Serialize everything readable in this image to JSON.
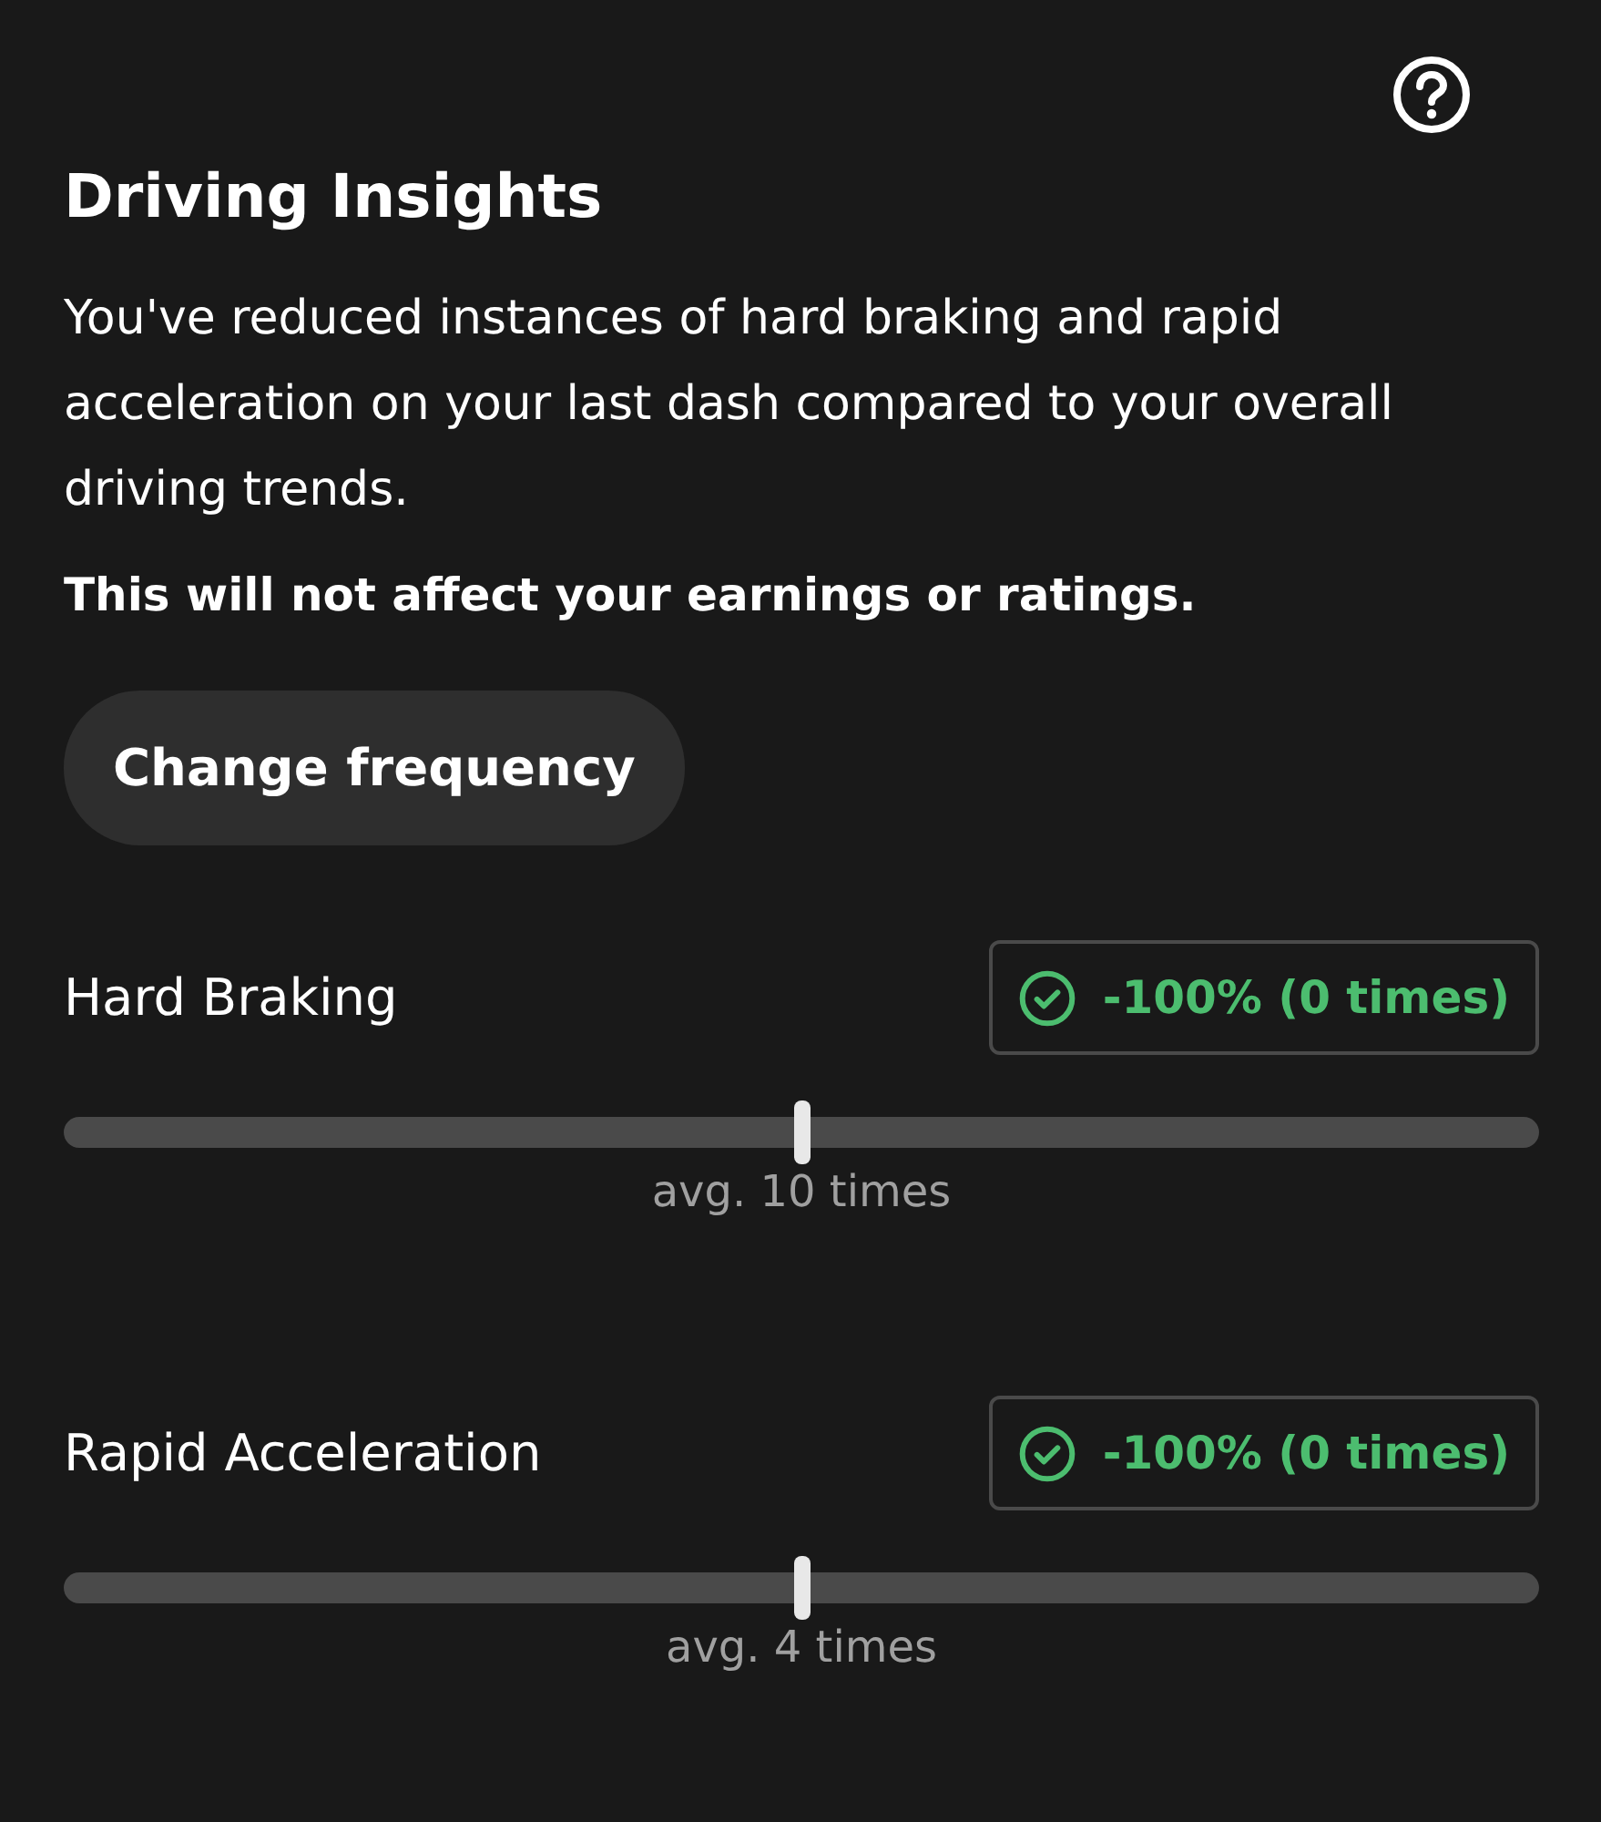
{
  "title": "Driving Insights",
  "description": "You've reduced instances of hard braking and rapid acceleration on your last dash compared to your overall driving trends.",
  "note": "This will not affect your earnings or ratings.",
  "button": "Change frequency",
  "metrics": [
    {
      "name": "Hard Braking",
      "badge": "-100% (0 times)",
      "level": 0.5,
      "average": "avg. 10 times"
    },
    {
      "name": "Rapid Acceleration",
      "badge": "-100% (0 times)",
      "level": 0.5,
      "average": "avg. 4 times"
    }
  ]
}
